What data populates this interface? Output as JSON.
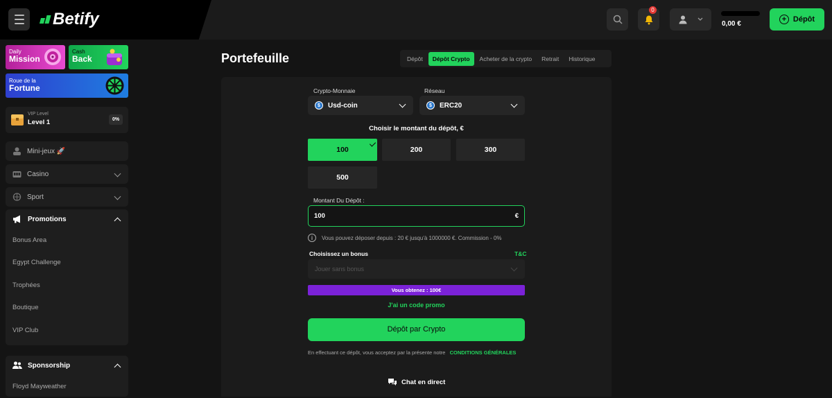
{
  "header": {
    "brand": "Betify",
    "notification_count": "0",
    "balance": "0,00 €",
    "deposit_label": "Dépôt"
  },
  "sidebar": {
    "promo_cards": [
      {
        "small": "Daily",
        "big": "Mission"
      },
      {
        "small": "Cash",
        "big": "Back"
      },
      {
        "small": "Roue de la",
        "big": "Fortune"
      }
    ],
    "vip": {
      "label": "VIP Level",
      "level": "Level 1",
      "progress": "0%"
    },
    "items": [
      {
        "label": "Mini-jeux 🚀"
      },
      {
        "label": "Casino"
      },
      {
        "label": "Sport"
      }
    ],
    "promotions": {
      "label": "Promotions",
      "items": [
        "Bonus Area",
        "Egypt Challenge",
        "Trophées",
        "Boutique",
        "VIP Club"
      ]
    },
    "sponsorship": {
      "label": "Sponsorship",
      "items": [
        "Floyd Mayweather"
      ]
    }
  },
  "main": {
    "title": "Portefeuille",
    "tabs": [
      {
        "label": "Dépôt",
        "active": false
      },
      {
        "label": "Dépôt Crypto",
        "active": true
      },
      {
        "label": "Acheter de la crypto",
        "active": false
      },
      {
        "label": "Retrait",
        "active": false
      },
      {
        "label": "Historique",
        "active": false
      }
    ],
    "crypto_label": "Crypto-Monnaie",
    "crypto_value": "Usd-coin",
    "network_label": "Réseau",
    "network_value": "ERC20",
    "amount_heading": "Choisir le montant du dépôt, €",
    "amounts": [
      "100",
      "200",
      "300",
      "500"
    ],
    "selected_amount": "100",
    "deposit_amount_label": "Montant Du Dépôt :",
    "deposit_amount_value": "100",
    "currency_symbol": "€",
    "info_text": "Vous pouvez déposer depuis : 20 € jusqu'à 1000000 €. Commission - 0%",
    "bonus_label": "Choisissez un bonus",
    "tnc_label": "T&C",
    "bonus_placeholder": "Jouer sans bonus",
    "obtain_text": "Vous obtenez : 100€",
    "promo_code_link": "J'ai un code promo",
    "cta_label": "Dépôt par Crypto",
    "terms_text": "En effectuant ce dépôt, vous acceptez par la présente notre",
    "terms_link": "CONDITIONS GÉNÉRALES",
    "chat_label": "Chat en direct"
  },
  "colors": {
    "accent": "#22d35c",
    "purple": "#7b22d8",
    "background": "#141414"
  }
}
